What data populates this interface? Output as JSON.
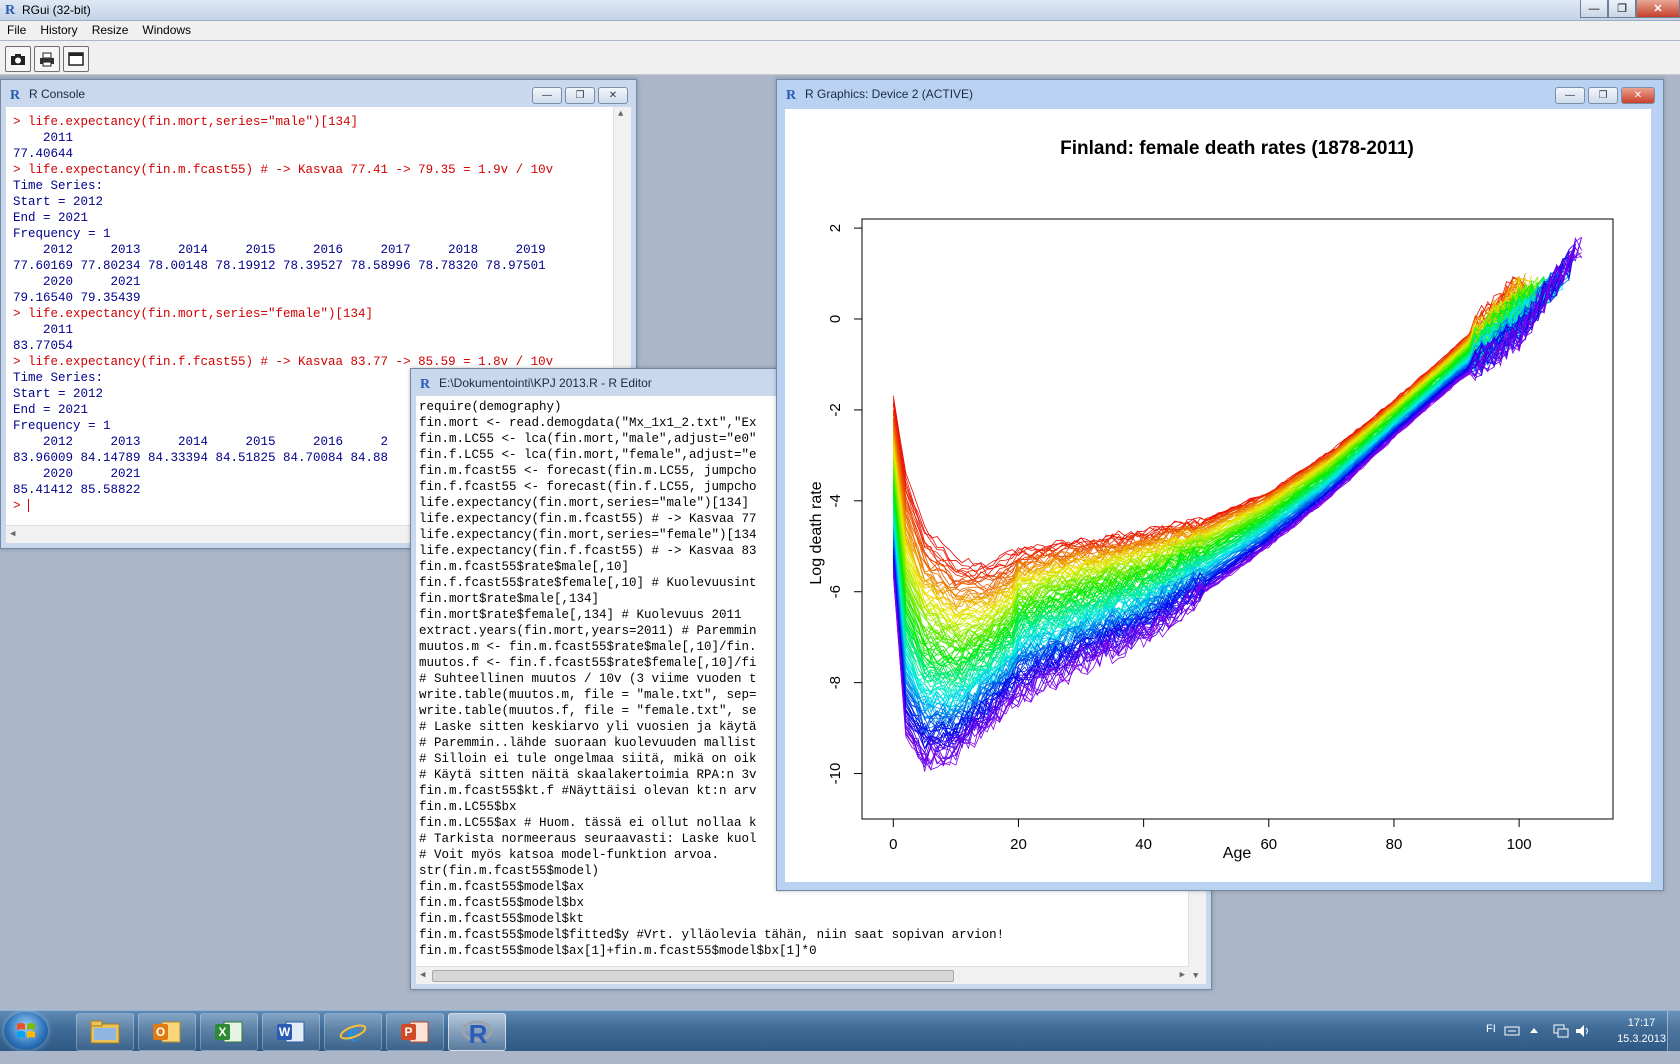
{
  "app": {
    "title": "RGui (32-bit)"
  },
  "menu": [
    "File",
    "History",
    "Resize",
    "Windows"
  ],
  "console": {
    "title": "R Console",
    "lines": [
      {
        "t": "> life.expectancy(fin.mort,series=\"male\")[134]",
        "k": "cmd"
      },
      {
        "t": "    2011",
        "k": "out"
      },
      {
        "t": "77.40644",
        "k": "out"
      },
      {
        "t": "> life.expectancy(fin.m.fcast55) # -> Kasvaa 77.41 -> 79.35 = 1.9v / 10v",
        "k": "cmd"
      },
      {
        "t": "Time Series:",
        "k": "out"
      },
      {
        "t": "Start = 2012",
        "k": "out"
      },
      {
        "t": "End = 2021",
        "k": "out"
      },
      {
        "t": "Frequency = 1",
        "k": "out"
      },
      {
        "t": "    2012     2013     2014     2015     2016     2017     2018     2019",
        "k": "out"
      },
      {
        "t": "77.60169 77.80234 78.00148 78.19912 78.39527 78.58996 78.78320 78.97501",
        "k": "out"
      },
      {
        "t": "    2020     2021",
        "k": "out"
      },
      {
        "t": "79.16540 79.35439",
        "k": "out"
      },
      {
        "t": "> life.expectancy(fin.mort,series=\"female\")[134]",
        "k": "cmd"
      },
      {
        "t": "    2011",
        "k": "out"
      },
      {
        "t": "83.77054",
        "k": "out"
      },
      {
        "t": "> life.expectancy(fin.f.fcast55) # -> Kasvaa 83.77 -> 85.59 = 1.8v / 10v",
        "k": "cmd"
      },
      {
        "t": "Time Series:",
        "k": "out"
      },
      {
        "t": "Start = 2012",
        "k": "out"
      },
      {
        "t": "End = 2021",
        "k": "out"
      },
      {
        "t": "Frequency = 1",
        "k": "out"
      },
      {
        "t": "    2012     2013     2014     2015     2016     2",
        "k": "out"
      },
      {
        "t": "83.96009 84.14789 84.33394 84.51825 84.70084 84.88",
        "k": "out"
      },
      {
        "t": "    2020     2021",
        "k": "out"
      },
      {
        "t": "85.41412 85.58822",
        "k": "out"
      },
      {
        "t": "> ",
        "k": "cmd"
      }
    ]
  },
  "editor": {
    "title": "E:\\Dokumentointi\\KPJ 2013.R - R Editor",
    "lines": [
      "require(demography)",
      "fin.mort <- read.demogdata(\"Mx_1x1_2.txt\",\"Ex",
      "fin.m.LC55 <- lca(fin.mort,\"male\",adjust=\"e0\"",
      "fin.f.LC55 <- lca(fin.mort,\"female\",adjust=\"e",
      "fin.m.fcast55 <- forecast(fin.m.LC55, jumpcho",
      "fin.f.fcast55 <- forecast(fin.f.LC55, jumpcho",
      "life.expectancy(fin.mort,series=\"male\")[134]",
      "life.expectancy(fin.m.fcast55) # -> Kasvaa 77",
      "life.expectancy(fin.mort,series=\"female\")[134",
      "life.expectancy(fin.f.fcast55) # -> Kasvaa 83",
      "fin.m.fcast55$rate$male[,10]",
      "fin.f.fcast55$rate$female[,10] # Kuolevuusint",
      "fin.mort$rate$male[,134]",
      "fin.mort$rate$female[,134] # Kuolevuus 2011",
      "extract.years(fin.mort,years=2011) # Paremmin",
      "muutos.m <- fin.m.fcast55$rate$male[,10]/fin.",
      "muutos.f <- fin.f.fcast55$rate$female[,10]/fi",
      "# Suhteellinen muutos / 10v (3 viime vuoden t",
      "write.table(muutos.m, file = \"male.txt\", sep=",
      "write.table(muutos.f, file = \"female.txt\", se",
      "# Laske sitten keskiarvo yli vuosien ja käytä",
      "# Paremmin..lähde suoraan kuolevuuden mallist",
      "# Silloin ei tule ongelmaa siitä, mikä on oik",
      "# Käytä sitten näitä skaalakertoimia RPA:n 3v",
      "fin.m.fcast55$kt.f #Näyttäisi olevan kt:n arv",
      "fin.m.LC55$bx",
      "fin.m.LC55$ax # Huom. tässä ei ollut nollaa k",
      "# Tarkista normeeraus seuraavasti: Laske kuol",
      "# Voit myös katsoa model-funktion arvoa.",
      "str(fin.m.fcast55$model)",
      "fin.m.fcast55$model$ax",
      "fin.m.fcast55$model$bx",
      "fin.m.fcast55$model$kt",
      "fin.m.fcast55$model$fitted$y #Vrt. ylläolevia tähän, niin saat sopivan arvion!",
      "fin.m.fcast55$model$ax[1]+fin.m.fcast55$model$bx[1]*0"
    ]
  },
  "graphics": {
    "title": "R Graphics: Device 2 (ACTIVE)"
  },
  "chart_data": {
    "type": "line",
    "title": "Finland: female death rates  (1878-2011)",
    "xlabel": "Age",
    "ylabel": "Log death rate",
    "xlim": [
      -5,
      115
    ],
    "ylim": [
      -11,
      2.2
    ],
    "xticks": [
      0,
      20,
      40,
      60,
      80,
      100
    ],
    "yticks": [
      2,
      0,
      -2,
      -4,
      -6,
      -8,
      -10
    ],
    "years": [
      1878,
      2011
    ],
    "palette": "rainbow (red = 1878 → violet = 2011)",
    "series_profile_early": {
      "age": [
        0,
        2,
        5,
        10,
        15,
        20,
        30,
        40,
        50,
        60,
        70,
        80,
        90,
        100
      ],
      "log_rate": [
        -1.7,
        -3.4,
        -4.6,
        -5.3,
        -5.4,
        -5.1,
        -4.9,
        -4.7,
        -4.4,
        -3.8,
        -2.9,
        -1.8,
        -0.6,
        0.8
      ]
    },
    "series_profile_late": {
      "age": [
        0,
        2,
        5,
        10,
        15,
        20,
        30,
        40,
        50,
        60,
        70,
        80,
        90,
        100,
        110
      ],
      "log_rate": [
        -5.6,
        -9.2,
        -9.8,
        -9.6,
        -8.9,
        -8.3,
        -7.6,
        -7.0,
        -6.0,
        -5.0,
        -3.9,
        -2.6,
        -1.4,
        -0.4,
        1.7
      ]
    }
  },
  "taskbar": {
    "apps": [
      "Windows Explorer",
      "Microsoft Outlook",
      "Microsoft Excel",
      "Microsoft Word",
      "Internet Explorer",
      "Microsoft PowerPoint",
      "RGui"
    ],
    "lang": "FI",
    "time": "17:17",
    "date": "15.3.2013"
  }
}
